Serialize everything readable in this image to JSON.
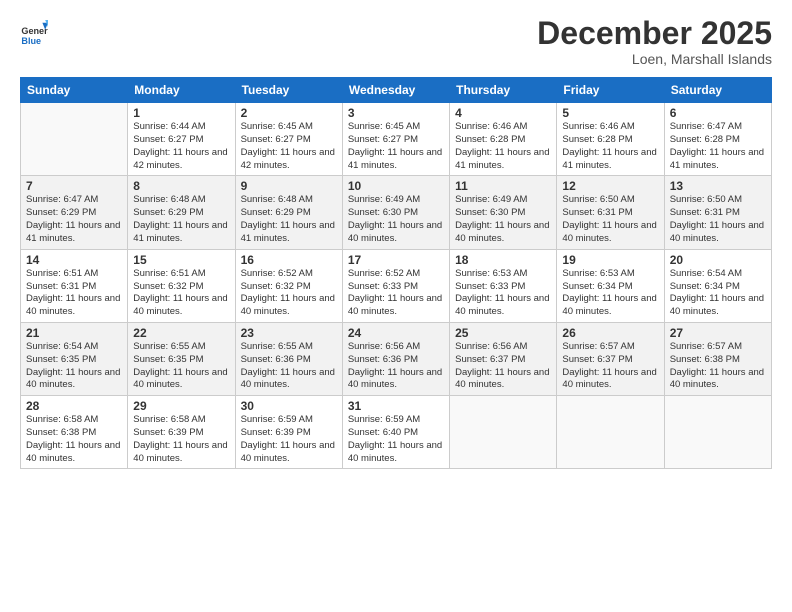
{
  "logo": {
    "general": "General",
    "blue": "Blue"
  },
  "header": {
    "month": "December 2025",
    "location": "Loen, Marshall Islands"
  },
  "weekdays": [
    "Sunday",
    "Monday",
    "Tuesday",
    "Wednesday",
    "Thursday",
    "Friday",
    "Saturday"
  ],
  "weeks": [
    [
      {
        "day": "",
        "sunrise": "",
        "sunset": "",
        "daylight": ""
      },
      {
        "day": "1",
        "sunrise": "Sunrise: 6:44 AM",
        "sunset": "Sunset: 6:27 PM",
        "daylight": "Daylight: 11 hours and 42 minutes."
      },
      {
        "day": "2",
        "sunrise": "Sunrise: 6:45 AM",
        "sunset": "Sunset: 6:27 PM",
        "daylight": "Daylight: 11 hours and 42 minutes."
      },
      {
        "day": "3",
        "sunrise": "Sunrise: 6:45 AM",
        "sunset": "Sunset: 6:27 PM",
        "daylight": "Daylight: 11 hours and 41 minutes."
      },
      {
        "day": "4",
        "sunrise": "Sunrise: 6:46 AM",
        "sunset": "Sunset: 6:28 PM",
        "daylight": "Daylight: 11 hours and 41 minutes."
      },
      {
        "day": "5",
        "sunrise": "Sunrise: 6:46 AM",
        "sunset": "Sunset: 6:28 PM",
        "daylight": "Daylight: 11 hours and 41 minutes."
      },
      {
        "day": "6",
        "sunrise": "Sunrise: 6:47 AM",
        "sunset": "Sunset: 6:28 PM",
        "daylight": "Daylight: 11 hours and 41 minutes."
      }
    ],
    [
      {
        "day": "7",
        "sunrise": "Sunrise: 6:47 AM",
        "sunset": "Sunset: 6:29 PM",
        "daylight": "Daylight: 11 hours and 41 minutes."
      },
      {
        "day": "8",
        "sunrise": "Sunrise: 6:48 AM",
        "sunset": "Sunset: 6:29 PM",
        "daylight": "Daylight: 11 hours and 41 minutes."
      },
      {
        "day": "9",
        "sunrise": "Sunrise: 6:48 AM",
        "sunset": "Sunset: 6:29 PM",
        "daylight": "Daylight: 11 hours and 41 minutes."
      },
      {
        "day": "10",
        "sunrise": "Sunrise: 6:49 AM",
        "sunset": "Sunset: 6:30 PM",
        "daylight": "Daylight: 11 hours and 40 minutes."
      },
      {
        "day": "11",
        "sunrise": "Sunrise: 6:49 AM",
        "sunset": "Sunset: 6:30 PM",
        "daylight": "Daylight: 11 hours and 40 minutes."
      },
      {
        "day": "12",
        "sunrise": "Sunrise: 6:50 AM",
        "sunset": "Sunset: 6:31 PM",
        "daylight": "Daylight: 11 hours and 40 minutes."
      },
      {
        "day": "13",
        "sunrise": "Sunrise: 6:50 AM",
        "sunset": "Sunset: 6:31 PM",
        "daylight": "Daylight: 11 hours and 40 minutes."
      }
    ],
    [
      {
        "day": "14",
        "sunrise": "Sunrise: 6:51 AM",
        "sunset": "Sunset: 6:31 PM",
        "daylight": "Daylight: 11 hours and 40 minutes."
      },
      {
        "day": "15",
        "sunrise": "Sunrise: 6:51 AM",
        "sunset": "Sunset: 6:32 PM",
        "daylight": "Daylight: 11 hours and 40 minutes."
      },
      {
        "day": "16",
        "sunrise": "Sunrise: 6:52 AM",
        "sunset": "Sunset: 6:32 PM",
        "daylight": "Daylight: 11 hours and 40 minutes."
      },
      {
        "day": "17",
        "sunrise": "Sunrise: 6:52 AM",
        "sunset": "Sunset: 6:33 PM",
        "daylight": "Daylight: 11 hours and 40 minutes."
      },
      {
        "day": "18",
        "sunrise": "Sunrise: 6:53 AM",
        "sunset": "Sunset: 6:33 PM",
        "daylight": "Daylight: 11 hours and 40 minutes."
      },
      {
        "day": "19",
        "sunrise": "Sunrise: 6:53 AM",
        "sunset": "Sunset: 6:34 PM",
        "daylight": "Daylight: 11 hours and 40 minutes."
      },
      {
        "day": "20",
        "sunrise": "Sunrise: 6:54 AM",
        "sunset": "Sunset: 6:34 PM",
        "daylight": "Daylight: 11 hours and 40 minutes."
      }
    ],
    [
      {
        "day": "21",
        "sunrise": "Sunrise: 6:54 AM",
        "sunset": "Sunset: 6:35 PM",
        "daylight": "Daylight: 11 hours and 40 minutes."
      },
      {
        "day": "22",
        "sunrise": "Sunrise: 6:55 AM",
        "sunset": "Sunset: 6:35 PM",
        "daylight": "Daylight: 11 hours and 40 minutes."
      },
      {
        "day": "23",
        "sunrise": "Sunrise: 6:55 AM",
        "sunset": "Sunset: 6:36 PM",
        "daylight": "Daylight: 11 hours and 40 minutes."
      },
      {
        "day": "24",
        "sunrise": "Sunrise: 6:56 AM",
        "sunset": "Sunset: 6:36 PM",
        "daylight": "Daylight: 11 hours and 40 minutes."
      },
      {
        "day": "25",
        "sunrise": "Sunrise: 6:56 AM",
        "sunset": "Sunset: 6:37 PM",
        "daylight": "Daylight: 11 hours and 40 minutes."
      },
      {
        "day": "26",
        "sunrise": "Sunrise: 6:57 AM",
        "sunset": "Sunset: 6:37 PM",
        "daylight": "Daylight: 11 hours and 40 minutes."
      },
      {
        "day": "27",
        "sunrise": "Sunrise: 6:57 AM",
        "sunset": "Sunset: 6:38 PM",
        "daylight": "Daylight: 11 hours and 40 minutes."
      }
    ],
    [
      {
        "day": "28",
        "sunrise": "Sunrise: 6:58 AM",
        "sunset": "Sunset: 6:38 PM",
        "daylight": "Daylight: 11 hours and 40 minutes."
      },
      {
        "day": "29",
        "sunrise": "Sunrise: 6:58 AM",
        "sunset": "Sunset: 6:39 PM",
        "daylight": "Daylight: 11 hours and 40 minutes."
      },
      {
        "day": "30",
        "sunrise": "Sunrise: 6:59 AM",
        "sunset": "Sunset: 6:39 PM",
        "daylight": "Daylight: 11 hours and 40 minutes."
      },
      {
        "day": "31",
        "sunrise": "Sunrise: 6:59 AM",
        "sunset": "Sunset: 6:40 PM",
        "daylight": "Daylight: 11 hours and 40 minutes."
      },
      {
        "day": "",
        "sunrise": "",
        "sunset": "",
        "daylight": ""
      },
      {
        "day": "",
        "sunrise": "",
        "sunset": "",
        "daylight": ""
      },
      {
        "day": "",
        "sunrise": "",
        "sunset": "",
        "daylight": ""
      }
    ]
  ]
}
